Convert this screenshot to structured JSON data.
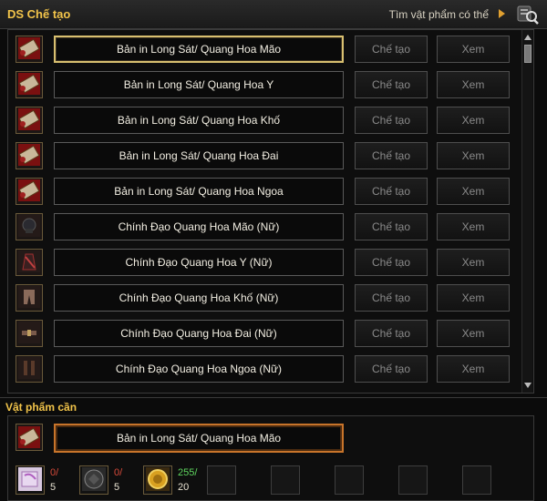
{
  "header": {
    "title": "DS Chế tạo",
    "find_label": "Tìm vật phẩm có thể"
  },
  "recipes": [
    {
      "name": "Bản in Long Sát/ Quang Hoa Mão",
      "icon": "scroll-icon",
      "make": "Chế tạo",
      "view": "Xem",
      "selected": true
    },
    {
      "name": "Bản in Long Sát/ Quang Hoa Y",
      "icon": "scroll-icon",
      "make": "Chế tạo",
      "view": "Xem"
    },
    {
      "name": "Bản in Long Sát/ Quang Hoa Khố",
      "icon": "scroll-icon",
      "make": "Chế tạo",
      "view": "Xem"
    },
    {
      "name": "Bản in Long Sát/ Quang Hoa Đai",
      "icon": "scroll-icon",
      "make": "Chế tạo",
      "view": "Xem"
    },
    {
      "name": "Bản in Long Sát/ Quang Hoa Ngoa",
      "icon": "scroll-icon",
      "make": "Chế tạo",
      "view": "Xem"
    },
    {
      "name": "Chính Đạo Quang Hoa Mão (Nữ)",
      "icon": "helmet-icon",
      "make": "Chế tạo",
      "view": "Xem"
    },
    {
      "name": "Chính Đạo Quang Hoa Y (Nữ)",
      "icon": "robe-icon",
      "make": "Chế tạo",
      "view": "Xem"
    },
    {
      "name": "Chính Đạo Quang Hoa Khố (Nữ)",
      "icon": "pants-icon",
      "make": "Chế tạo",
      "view": "Xem"
    },
    {
      "name": "Chính Đạo Quang Hoa Đai (Nữ)",
      "icon": "belt-icon",
      "make": "Chế tạo",
      "view": "Xem"
    },
    {
      "name": "Chính Đạo Quang Hoa Ngoa (Nữ)",
      "icon": "boots-icon",
      "make": "Chế tạo",
      "view": "Xem"
    }
  ],
  "required": {
    "title": "Vật phẩm cần",
    "target_name": "Bản in Long Sát/ Quang Hoa Mão",
    "materials": [
      {
        "icon": "pink-scroll-icon",
        "have": "0/",
        "need": "5",
        "status": "red"
      },
      {
        "icon": "dark-ore-icon",
        "have": "0/",
        "need": "5",
        "status": "red"
      },
      {
        "icon": "gold-coin-icon",
        "have": "255/",
        "need": "20",
        "status": "green"
      }
    ]
  },
  "colors": {
    "title": "#f2c44a",
    "selected_border": "#d9c070",
    "target_border": "#c8742a",
    "insufficient": "#d84a3a",
    "sufficient": "#5ed45e"
  }
}
